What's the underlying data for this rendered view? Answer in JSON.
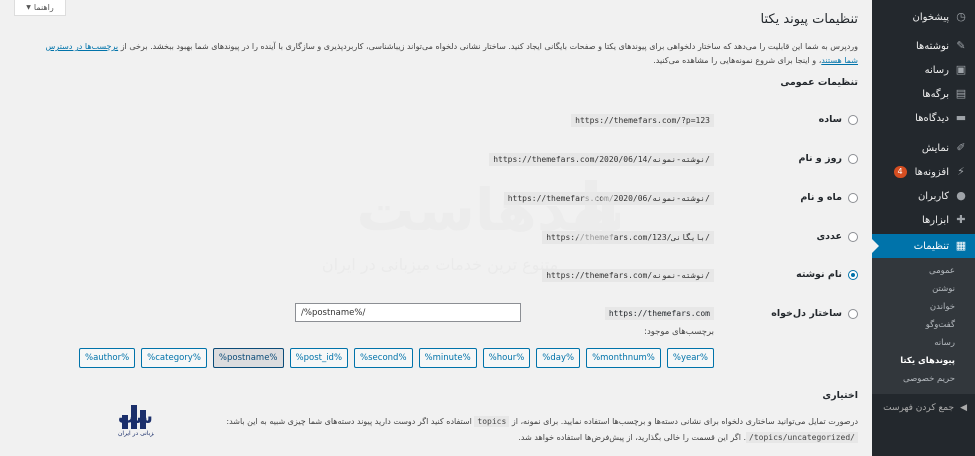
{
  "sidebar": {
    "items": [
      {
        "label": "پیشخوان",
        "icon": "dashboard-icon"
      },
      {
        "label": "نوشته‌ها",
        "icon": "pin-icon"
      },
      {
        "label": "رسانه",
        "icon": "media-icon"
      },
      {
        "label": "برگه‌ها",
        "icon": "page-icon"
      },
      {
        "label": "دیدگاه‌ها",
        "icon": "comment-icon"
      },
      {
        "label": "نمایش",
        "icon": "brush-icon"
      },
      {
        "label": "افزونه‌ها",
        "icon": "plugin-icon",
        "badge": "4"
      },
      {
        "label": "کاربران",
        "icon": "user-icon"
      },
      {
        "label": "ابزارها",
        "icon": "wrench-icon"
      },
      {
        "label": "تنظیمات",
        "icon": "settings-icon",
        "active": true
      }
    ],
    "submenu": [
      "عمومی",
      "نوشتن",
      "خواندن",
      "گفت‌وگو",
      "رسانه",
      "پیوندهای یکتا",
      "حریم خصوصی"
    ],
    "submenu_current": "پیوندهای یکتا",
    "collapse_label": "جمع کردن فهرست"
  },
  "help_tab": {
    "label": "راهنما"
  },
  "page": {
    "title": "تنظیمات پیوند یکتا",
    "intro": "وردپرس به شما این قابلیت را می‌دهد که ساختار دلخواهی برای پیوندهای یکتا و صفحات بایگانی ایجاد کنید. ساختار نشانی دلخواه می‌تواند زیباشناسی، کاربردپذیری و سازگاری با آینده را در پیوندهای شما بهبود ببخشد. برخی از",
    "intro_link": "برچسب‌ها در دسترس شما هستند",
    "intro_tail": "، و اینجا برای شروع نمونه‌هایی را مشاهده می‌کنید.",
    "section_general": "تنظیمات عمومی",
    "section_optional": "اختیاری",
    "optional_text_1": "درصورت تمایل می‌توانید ساختاری دلخواه برای نشانی دسته‌ها و برچسب‌ها استفاده نمایید. برای نمونه، از",
    "optional_code_1": "topics",
    "optional_text_2": "استفاده کنید اگر دوست دارید پیوند دسته‌های شما چیزی شبیه به این باشد:",
    "optional_code_2": "/topics/uncategorized/",
    "optional_text_3": ". اگر این قسمت را خالی بگذارید، از پیش‌فرض‌ها استفاده خواهد شد."
  },
  "options": [
    {
      "label": "ساده",
      "example": "https://themefars.com/?p=123",
      "checked": false
    },
    {
      "label": "روز و نام",
      "example": "https://themefars.com/2020/06/14/نوشته-نمونه/",
      "checked": false
    },
    {
      "label": "ماه و نام",
      "example": "https://themefars.com/2020/06/نوشته-نمونه/",
      "checked": false
    },
    {
      "label": "عددی",
      "example": "https://themefars.com/123/بایگانی/",
      "checked": false
    },
    {
      "label": "نام نوشته",
      "example": "https://themefars.com/نوشته-نمونه/",
      "checked": true
    },
    {
      "label": "ساختار دل‌خواه",
      "checked": false
    }
  ],
  "custom": {
    "base": "https://themefars.com",
    "value": "/%postname%/",
    "tags_label": "برچسب‌های موجود:",
    "tags": [
      "%year%",
      "%monthnum%",
      "%day%",
      "%hour%",
      "%minute%",
      "%second%",
      "%post_id%",
      "%postname%",
      "%category%",
      "%author%"
    ],
    "selected_tag": "%postname%"
  },
  "watermark": {
    "brand": "مشهدهاست",
    "tagline": "متنوع ترین خدمات میزبانی در ایران"
  },
  "colors": {
    "accent": "#0073aa",
    "sidebar": "#23282d",
    "badge": "#d54e21"
  }
}
